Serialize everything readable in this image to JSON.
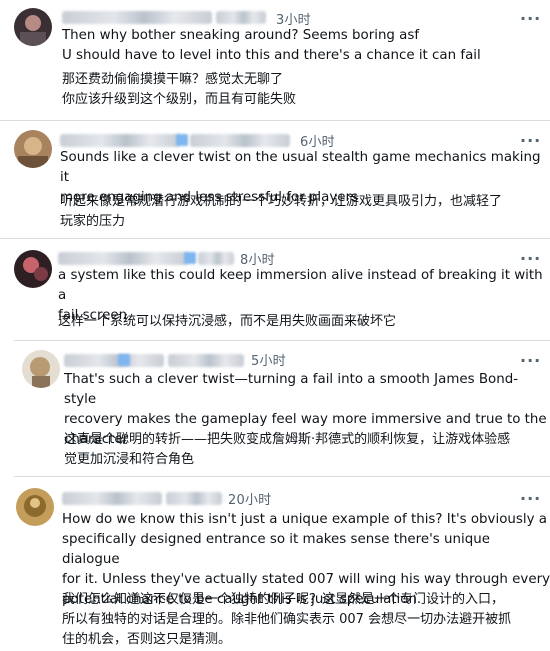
{
  "comments": [
    {
      "time": "3小时",
      "more": "···",
      "en": "Then why bother sneaking around? Seems boring asf\nU should have to level into this and there's a chance it can fail",
      "zh": "那还费劲偷偷摸摸干嘛？感觉太无聊了\n你应该升级到这个级别，而且有可能失败"
    },
    {
      "time": "6小时",
      "more": "···",
      "en": "Sounds like a clever twist on the usual stealth game mechanics making it\nmore engaging and less stressful for players",
      "zh": "听起来像是常规潜行游戏机制的一个巧妙转折，让游戏更具吸引力，也减轻了\n玩家的压力"
    },
    {
      "time": "8小时",
      "more": "···",
      "en": "a system like this could keep immersion alive instead of breaking it with a\nfail screen",
      "zh": "这样一个系统可以保持沉浸感，而不是用失败画面来破坏它"
    },
    {
      "time": "5小时",
      "more": "···",
      "en": "That's such a clever twist—turning a fail into a smooth James Bond-style\nrecovery makes the gameplay feel way more immersive and true to the\ncharacter",
      "zh": "这真是个聪明的转折——把失败变成詹姆斯·邦德式的顺利恢复，让游戏体验感\n觉更加沉浸和符合角色"
    },
    {
      "time": "20小时",
      "more": "···",
      "en": "How do we know this isn't just a unique example of this? It's obviously a\nspecifically designed entrance so it makes sense there's unique dialogue\nfor it. Unless they've actually stated 007 will wing his way through every\npotential chance to be caught this is just speculation.",
      "zh": "我们怎么知道这不仅仅是一个独特的例子呢？这显然是一个专门设计的入口，\n所以有独特的对话是合理的。除非他们确实表示 007 会想尽一切办法避开被抓\n住的机会，否则这只是猜测。"
    }
  ]
}
